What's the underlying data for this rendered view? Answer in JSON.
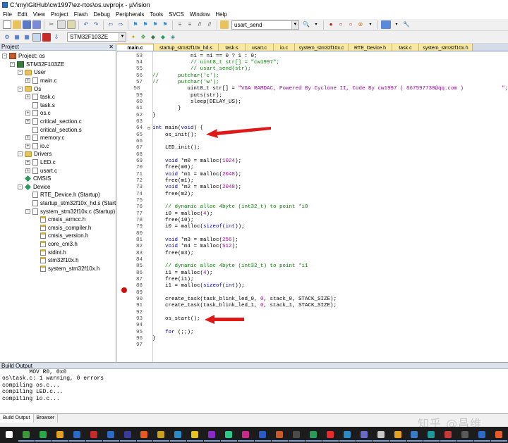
{
  "window": {
    "title": "C:\\my\\GitHub\\cw1997\\ez-rtos\\os.uvprojx - µVision"
  },
  "menu": [
    "File",
    "Edit",
    "View",
    "Project",
    "Flash",
    "Debug",
    "Peripherals",
    "Tools",
    "SVCS",
    "Window",
    "Help"
  ],
  "toolbar": {
    "find_value": "usart_send",
    "target_value": "STM32F103ZE"
  },
  "project_panel": {
    "title": "Project",
    "tree": [
      {
        "label": "Project: os",
        "indent": 0,
        "exp": "-",
        "icon": "proj"
      },
      {
        "label": "STM32F103ZE",
        "indent": 1,
        "exp": "-",
        "icon": "chip"
      },
      {
        "label": "User",
        "indent": 2,
        "exp": "-",
        "icon": "folder"
      },
      {
        "label": "main.c",
        "indent": 3,
        "exp": "+",
        "icon": "file"
      },
      {
        "label": "Os",
        "indent": 2,
        "exp": "-",
        "icon": "folder"
      },
      {
        "label": "task.c",
        "indent": 3,
        "exp": "+",
        "icon": "file"
      },
      {
        "label": "task.s",
        "indent": 3,
        "exp": "",
        "icon": "file"
      },
      {
        "label": "os.c",
        "indent": 3,
        "exp": "+",
        "icon": "file"
      },
      {
        "label": "critical_section.c",
        "indent": 3,
        "exp": "+",
        "icon": "file"
      },
      {
        "label": "critical_section.s",
        "indent": 3,
        "exp": "",
        "icon": "file"
      },
      {
        "label": "memory.c",
        "indent": 3,
        "exp": "+",
        "icon": "file"
      },
      {
        "label": "io.c",
        "indent": 3,
        "exp": "+",
        "icon": "file"
      },
      {
        "label": "Drivers",
        "indent": 2,
        "exp": "-",
        "icon": "folder"
      },
      {
        "label": "LED.c",
        "indent": 3,
        "exp": "+",
        "icon": "file"
      },
      {
        "label": "usart.c",
        "indent": 3,
        "exp": "+",
        "icon": "file"
      },
      {
        "label": "CMSIS",
        "indent": 2,
        "exp": "",
        "icon": "gem"
      },
      {
        "label": "Device",
        "indent": 2,
        "exp": "-",
        "icon": "gem"
      },
      {
        "label": "RTE_Device.h (Startup)",
        "indent": 3,
        "exp": "",
        "icon": "file"
      },
      {
        "label": "startup_stm32f10x_hd.s (Startup)",
        "indent": 3,
        "exp": "",
        "icon": "file"
      },
      {
        "label": "system_stm32f10x.c (Startup)",
        "indent": 3,
        "exp": "-",
        "icon": "file"
      },
      {
        "label": "cmsis_armcc.h",
        "indent": 4,
        "exp": "",
        "icon": "hfile"
      },
      {
        "label": "cmsis_compiler.h",
        "indent": 4,
        "exp": "",
        "icon": "hfile"
      },
      {
        "label": "cmsis_version.h",
        "indent": 4,
        "exp": "",
        "icon": "hfile"
      },
      {
        "label": "core_cm3.h",
        "indent": 4,
        "exp": "",
        "icon": "hfile"
      },
      {
        "label": "stdint.h",
        "indent": 4,
        "exp": "",
        "icon": "hfile"
      },
      {
        "label": "stm32f10x.h",
        "indent": 4,
        "exp": "",
        "icon": "hfile"
      },
      {
        "label": "system_stm32f10x.h",
        "indent": 4,
        "exp": "",
        "icon": "hfile"
      }
    ],
    "tabs": [
      "Project",
      "Books",
      "Functions",
      "Templates"
    ]
  },
  "editor_tabs": [
    {
      "label": "main.c",
      "w": 52,
      "active": true
    },
    {
      "label": "startup_stm32f10x_hd.s",
      "w": 92
    },
    {
      "label": "task.s",
      "w": 38
    },
    {
      "label": "usart.c",
      "w": 40
    },
    {
      "label": "io.c",
      "w": 30
    },
    {
      "label": "system_stm32f10x.c",
      "w": 76
    },
    {
      "label": "RTE_Device.h",
      "w": 62
    },
    {
      "label": "task.c",
      "w": 38
    },
    {
      "label": "system_stm32f10x.h",
      "w": 76
    }
  ],
  "code_lines": [
    {
      "n": "53",
      "parts": [
        [
          "tx",
          "            n1 = n1 == 0 ? 1 : 0;"
        ]
      ]
    },
    {
      "n": "54",
      "parts": [
        [
          "cm",
          "            // uint8_t str[] = \"cw1997\";"
        ]
      ]
    },
    {
      "n": "55",
      "parts": [
        [
          "cm",
          "            // usart_send(str);"
        ]
      ]
    },
    {
      "n": "56",
      "parts": [
        [
          "cm",
          "//      putchar('c');"
        ]
      ]
    },
    {
      "n": "57",
      "parts": [
        [
          "cm",
          "//      putchar('w');"
        ]
      ]
    },
    {
      "n": "58",
      "parts": [
        [
          "tx",
          "            uint8_t str[] = "
        ],
        [
          "str",
          "\"VGA RAMDAC, Powered By Cyclone II, Code By cw1997 ( 867597730@qq.com )            \";"
        ]
      ]
    },
    {
      "n": "59",
      "parts": [
        [
          "tx",
          "            puts(str);"
        ]
      ]
    },
    {
      "n": "60",
      "parts": [
        [
          "tx",
          "            sleep(DELAY_US);"
        ]
      ]
    },
    {
      "n": "61",
      "parts": [
        [
          "tx",
          "        }"
        ]
      ]
    },
    {
      "n": "62",
      "parts": [
        [
          "tx",
          "}"
        ]
      ]
    },
    {
      "n": "63",
      "parts": [
        [
          "tx",
          ""
        ]
      ]
    },
    {
      "n": "64",
      "fold": "⊟",
      "parts": [
        [
          "kw",
          "int"
        ],
        [
          "tx",
          " main("
        ],
        [
          "kw",
          "void"
        ],
        [
          "tx",
          ") {"
        ]
      ]
    },
    {
      "n": "65",
      "parts": [
        [
          "tx",
          "    os_init();"
        ]
      ]
    },
    {
      "n": "66",
      "parts": [
        [
          "tx",
          ""
        ]
      ]
    },
    {
      "n": "67",
      "parts": [
        [
          "tx",
          "    LED_init();"
        ]
      ]
    },
    {
      "n": "68",
      "parts": [
        [
          "tx",
          ""
        ]
      ]
    },
    {
      "n": "69",
      "parts": [
        [
          "tx",
          "    "
        ],
        [
          "kw",
          "void"
        ],
        [
          "tx",
          " *m0 = malloc("
        ],
        [
          "num",
          "1024"
        ],
        [
          "tx",
          ");"
        ]
      ]
    },
    {
      "n": "70",
      "parts": [
        [
          "tx",
          "    free(m0);"
        ]
      ]
    },
    {
      "n": "71",
      "parts": [
        [
          "tx",
          "    "
        ],
        [
          "kw",
          "void"
        ],
        [
          "tx",
          " *m1 = malloc("
        ],
        [
          "num",
          "2048"
        ],
        [
          "tx",
          ");"
        ]
      ]
    },
    {
      "n": "72",
      "parts": [
        [
          "tx",
          "    free(m1);"
        ]
      ]
    },
    {
      "n": "73",
      "parts": [
        [
          "tx",
          "    "
        ],
        [
          "kw",
          "void"
        ],
        [
          "tx",
          " *m2 = malloc("
        ],
        [
          "num",
          "2048"
        ],
        [
          "tx",
          ");"
        ]
      ]
    },
    {
      "n": "74",
      "parts": [
        [
          "tx",
          "    free(m2);"
        ]
      ]
    },
    {
      "n": "75",
      "parts": [
        [
          "tx",
          ""
        ]
      ]
    },
    {
      "n": "76",
      "parts": [
        [
          "cm",
          "    // dynamic alloc 4byte (int32_t) to point *i0"
        ]
      ]
    },
    {
      "n": "77",
      "parts": [
        [
          "tx",
          "    i0 = malloc("
        ],
        [
          "num",
          "4"
        ],
        [
          "tx",
          ");"
        ]
      ]
    },
    {
      "n": "78",
      "parts": [
        [
          "tx",
          "    free(i0);"
        ]
      ]
    },
    {
      "n": "79",
      "parts": [
        [
          "tx",
          "    i0 = malloc("
        ],
        [
          "kw",
          "sizeof"
        ],
        [
          "tx",
          "("
        ],
        [
          "kw",
          "int"
        ],
        [
          "tx",
          "));"
        ]
      ]
    },
    {
      "n": "80",
      "parts": [
        [
          "tx",
          ""
        ]
      ]
    },
    {
      "n": "81",
      "parts": [
        [
          "tx",
          "    "
        ],
        [
          "kw",
          "void"
        ],
        [
          "tx",
          " *m3 = malloc("
        ],
        [
          "num",
          "256"
        ],
        [
          "tx",
          ");"
        ]
      ]
    },
    {
      "n": "82",
      "parts": [
        [
          "tx",
          "    "
        ],
        [
          "kw",
          "void"
        ],
        [
          "tx",
          " *m4 = malloc("
        ],
        [
          "num",
          "512"
        ],
        [
          "tx",
          ");"
        ]
      ]
    },
    {
      "n": "83",
      "parts": [
        [
          "tx",
          "    free(m3);"
        ]
      ]
    },
    {
      "n": "84",
      "parts": [
        [
          "tx",
          ""
        ]
      ]
    },
    {
      "n": "85",
      "parts": [
        [
          "cm",
          "    // dynamic alloc 4byte (int32_t) to point *i1"
        ]
      ]
    },
    {
      "n": "86",
      "parts": [
        [
          "tx",
          "    i1 = malloc("
        ],
        [
          "num",
          "4"
        ],
        [
          "tx",
          ");"
        ]
      ]
    },
    {
      "n": "87",
      "parts": [
        [
          "tx",
          "    free(i1);"
        ]
      ]
    },
    {
      "n": "88",
      "parts": [
        [
          "tx",
          "    i1 = malloc("
        ],
        [
          "kw",
          "sizeof"
        ],
        [
          "tx",
          "("
        ],
        [
          "kw",
          "int"
        ],
        [
          "tx",
          "));"
        ]
      ]
    },
    {
      "n": "89",
      "parts": [
        [
          "tx",
          ""
        ]
      ]
    },
    {
      "n": "90",
      "parts": [
        [
          "tx",
          "    create_task(task_blink_led_0, "
        ],
        [
          "num",
          "0"
        ],
        [
          "tx",
          ", stack_0, STACK_SIZE);"
        ]
      ]
    },
    {
      "n": "91",
      "parts": [
        [
          "tx",
          "    create_task(task_blink_led_1, "
        ],
        [
          "num",
          "0"
        ],
        [
          "tx",
          ", stack_1, STACK_SIZE);"
        ]
      ]
    },
    {
      "n": "92",
      "parts": [
        [
          "tx",
          ""
        ]
      ]
    },
    {
      "n": "93",
      "parts": [
        [
          "tx",
          "    os_start();"
        ]
      ]
    },
    {
      "n": "94",
      "parts": [
        [
          "tx",
          ""
        ]
      ]
    },
    {
      "n": "95",
      "parts": [
        [
          "tx",
          "    "
        ],
        [
          "kw",
          "for"
        ],
        [
          "tx",
          " (;;);"
        ]
      ]
    },
    {
      "n": "96",
      "parts": [
        [
          "tx",
          "}"
        ]
      ]
    },
    {
      "n": "97",
      "parts": [
        [
          "tx",
          ""
        ]
      ]
    }
  ],
  "build_output": {
    "title": "Build Output",
    "lines": [
      "        MOV R0, 0x0",
      "os\\task.c: 1 warning, 0 errors",
      "compiling os.c...",
      "compiling LED.c...",
      "compiling io.c..."
    ],
    "tabs": [
      "Build Output",
      "Browser"
    ]
  },
  "watermark": "知乎 @昌维",
  "colors": {
    "arrow": "#e01818",
    "breakpoint": "#d01010",
    "accent": "#2e6fbf"
  }
}
